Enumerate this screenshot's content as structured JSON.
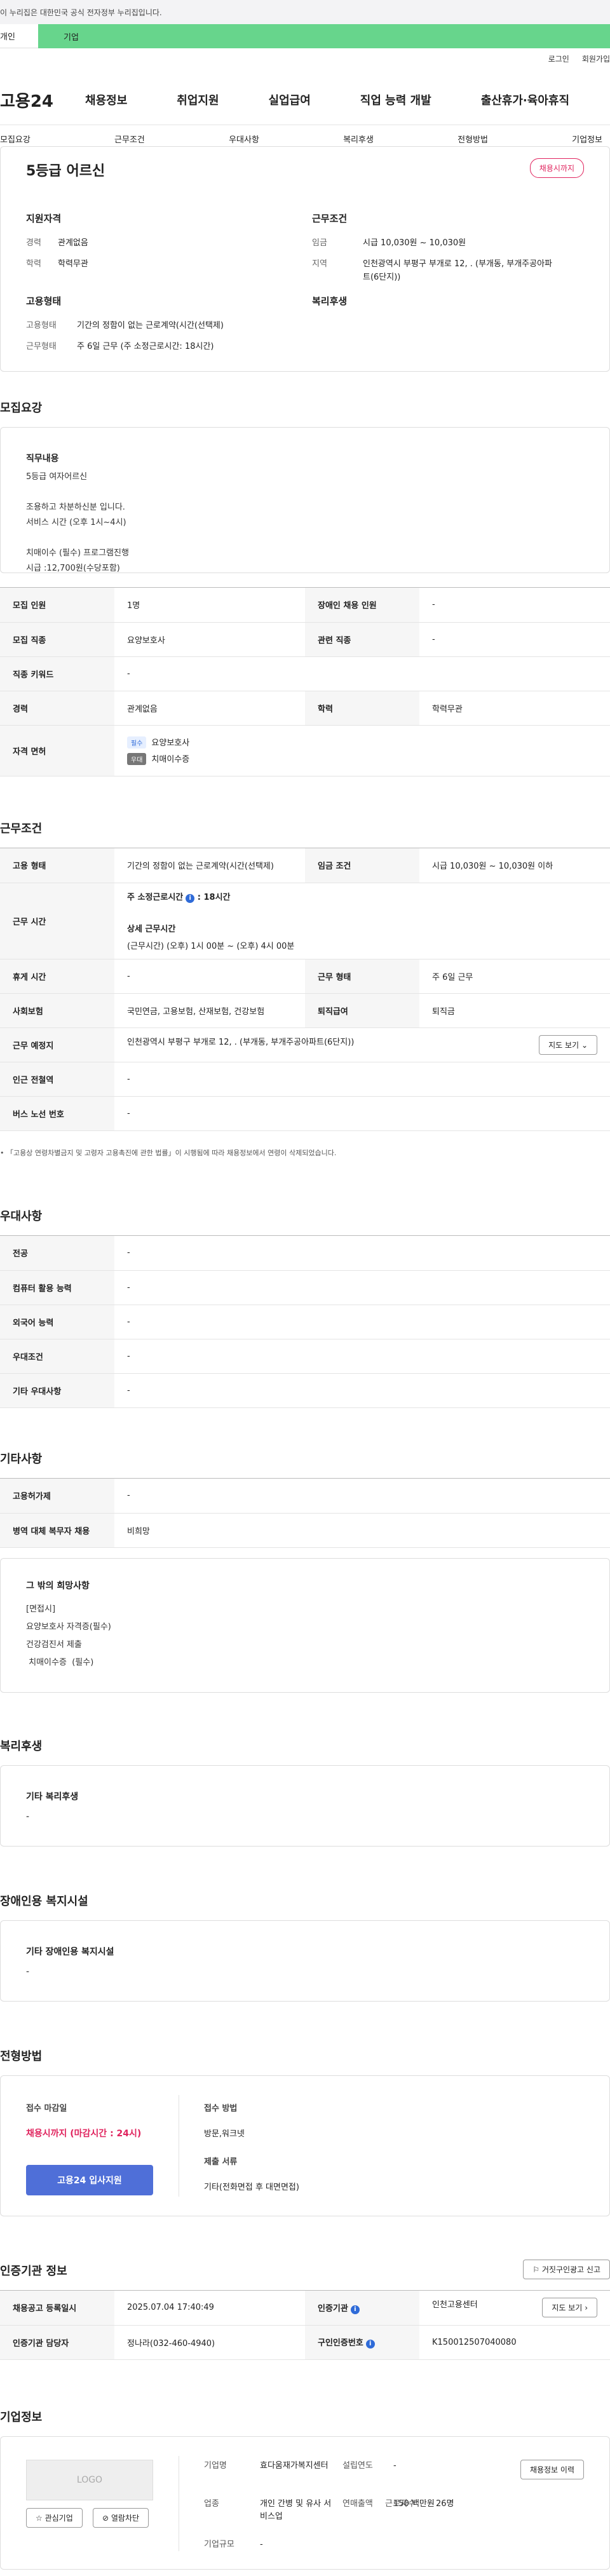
{
  "gov_banner": "이 누리집은 대한민국 공식 전자정부 누리집입니다.",
  "top_tabs": [
    "개인",
    "기업"
  ],
  "util": [
    "로그인",
    "회원가입"
  ],
  "logo": "고용24",
  "gnb": [
    "채용정보",
    "취업지원",
    "실업급여",
    "직업 능력 개발",
    "출산휴가·육아휴직"
  ],
  "sub_tabs": [
    "모집요강",
    "근무조건",
    "우대사항",
    "복리후생",
    "전형방법",
    "기업정보"
  ],
  "summary": {
    "title": "5등급 어르신",
    "badge": "채용시까지",
    "qual_title": "지원자격",
    "qual": [
      {
        "k": "경력",
        "v": "관계없음"
      },
      {
        "k": "학력",
        "v": "학력무관"
      }
    ],
    "cond_title": "근무조건",
    "cond": [
      {
        "k": "임금",
        "v": "시급 10,030원 ~ 10,030원"
      },
      {
        "k": "지역",
        "v": "인천광역시 부평구 부개로 12, . (부개동, 부개주공아파"
      },
      {
        "k": "",
        "v": "트(6단지))"
      }
    ],
    "emp_title": "고용형태",
    "emp": [
      {
        "k": "고용형태",
        "v": "기간의 정함이 없는 근로계약(시간(선택제)"
      },
      {
        "k": "근무형태",
        "v": "주 6일 근무 (주 소정근로시간: 18시간)"
      }
    ],
    "welfare_title": "복리후생"
  },
  "recruit": {
    "title": "모집요강",
    "duty_title": "직무내용",
    "duty": "5등급 여자어르신\n\n조용하고 차분하신분 입니다.\n서비스 시간 (오후 1시~4시)\n\n치매이수 (필수) 프로그램진행\n시급 :12,700원(수당포함)",
    "rows": [
      [
        "모집 인원",
        "1명",
        "장애인 채용 인원",
        "-"
      ],
      [
        "모집 직종",
        "요양보호사",
        "관련 직종",
        "-"
      ],
      [
        "직종 키워드",
        "-"
      ],
      [
        "경력",
        "관계없음",
        "학력",
        "학력무관"
      ]
    ],
    "license_label": "자격 면허",
    "lic": [
      {
        "tag": "필수",
        "name": "요양보호사"
      },
      {
        "tag": "우대",
        "name": "치매이수증"
      }
    ]
  },
  "work": {
    "title": "근무조건",
    "r1": [
      "고용 형태",
      "기간의 정함이 없는 근로계약(시간(선택제)",
      "임금 조건",
      "시급 10,030원 ~ 10,030원 이하"
    ],
    "time_label": "근무 시간",
    "time_a": "주 소정근로시간",
    "time_b": ": 18시간",
    "time_c": "상세 근무시간",
    "time_d": "(근무시간) (오후) 1시 00분 ~ (오후) 4시 00분",
    "r3": [
      "휴게 시간",
      "-",
      "근무 형태",
      "주 6일 근무"
    ],
    "r4": [
      "사회보험",
      "국민연금, 고용보험, 산재보험, 건강보험",
      "퇴직급여",
      "퇴직금"
    ],
    "r5": [
      "근무 예정지",
      "인천광역시 부평구 부개로 12, . (부개동, 부개주공아파트(6단지))"
    ],
    "map_btn": "지도 보기",
    "r6": [
      "인근 전철역",
      "-"
    ],
    "r7": [
      "버스 노선 번호",
      "-"
    ],
    "note": "「고용상 연령차별금지 및 고령자 고용촉진에 관한 법률」이 시행됨에 따라 채용정보에서 연령이 삭제되었습니다."
  },
  "pref": {
    "title": "우대사항",
    "rows": [
      [
        "전공",
        "-"
      ],
      [
        "컴퓨터 활용 능력",
        "-"
      ],
      [
        "외국어 능력",
        "-"
      ],
      [
        "우대조건",
        "-"
      ],
      [
        "기타 우대사항",
        "-"
      ]
    ]
  },
  "etc": {
    "title": "기타사항",
    "rows": [
      [
        "고용허가제",
        "-"
      ],
      [
        "병역 대체 복무자 채용",
        "비희망"
      ]
    ],
    "box_title": "그 밖의 희망사항",
    "box": "[면접시]\n요양보호사 자격증(필수)\n건강검진서 제출\n 치매이수증  (필수)"
  },
  "benefit": {
    "title": "복리후생",
    "sub": "기타 복리후생",
    "val": "-"
  },
  "disab": {
    "title": "장애인용 복지시설",
    "sub": "기타 장애인용 복지시설",
    "val": "-"
  },
  "process": {
    "title": "전형방법",
    "deadline_label": "접수 마감일",
    "deadline": "채용시까지 (마감시간 : 24시)",
    "apply": "고용24 입사지원",
    "method_label": "접수 방법",
    "method": "방문,워크넷",
    "docs_label": "제출 서류",
    "docs": "기타(전화면접 후 대면면접)"
  },
  "agency": {
    "title": "인증기관 정보",
    "report": "거짓구인광고 신고",
    "r1": [
      "채용공고 등록일시",
      "2025.07.04 17:40:49",
      "인증기관",
      "인천고용센터"
    ],
    "map": "지도 보기",
    "r2": [
      "인증기관 담당자",
      "정나라(032-460-4940)",
      "구인인증번호",
      "K150012507040080"
    ]
  },
  "company": {
    "title": "기업정보",
    "logo": "LOGO",
    "fav": "관심기업",
    "block": "열람차단",
    "f": [
      [
        "기업명",
        "효다움재가복지센터",
        "설립연도",
        "-"
      ],
      [
        "업종",
        "개인 간병 및 유사 서비스업",
        "연매출액",
        "150 백만원"
      ],
      [
        "기업규모",
        "-",
        "근로자수",
        "26명"
      ]
    ],
    "hist": "채용정보 이력"
  }
}
